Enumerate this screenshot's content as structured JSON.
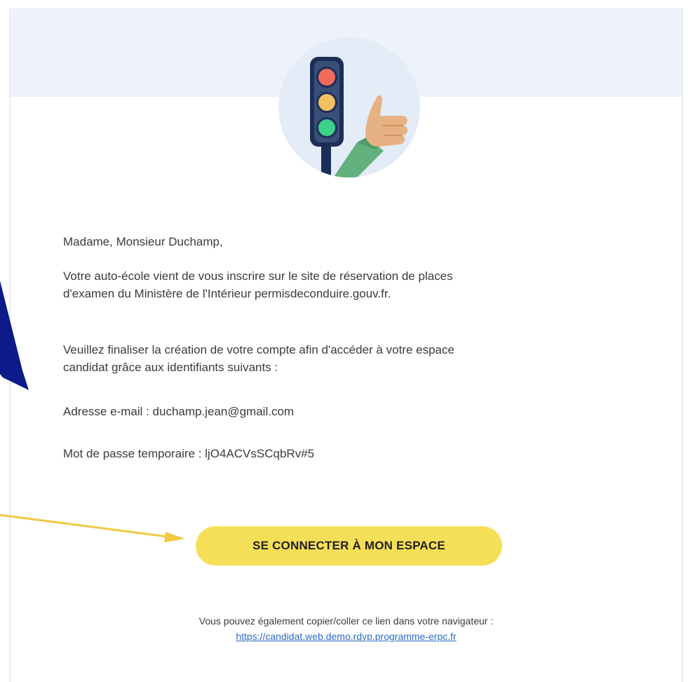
{
  "greeting": "Madame, Monsieur Duchamp,",
  "paragraph_1_line_1": "Votre auto-école vient de vous inscrire sur le site de réservation de places",
  "paragraph_1_line_2": "d'examen du Ministère de l'Intérieur permisdeconduire.gouv.fr.",
  "paragraph_2_line_1": "Veuillez finaliser la création de votre compte afin d'accéder à votre espace",
  "paragraph_2_line_2": "candidat grâce aux identifiants suivants :",
  "email_line": "Adresse e-mail : duchamp.jean@gmail.com",
  "password_line": "Mot de passe temporaire : ljO4ACVsSCqbRv#5",
  "cta_label": "SE CONNECTER À MON ESPACE",
  "footer_text": "Vous pouvez également copier/coller ce lien dans votre navigateur :",
  "footer_link": "https://candidat.web.demo.rdvp.programme-erpc.fr",
  "colors": {
    "header_band": "#eef2fa",
    "cta_background": "#f6df58",
    "link": "#2b6ac9",
    "annotation_blue_arrow": "#0c1a8a",
    "annotation_yellow_arrow": "#f2c842"
  },
  "icons": {
    "hero": "traffic-light-thumbs-up-illustration",
    "annotation_1": "blue-arrow-annotation",
    "annotation_2": "yellow-arrow-annotation"
  }
}
